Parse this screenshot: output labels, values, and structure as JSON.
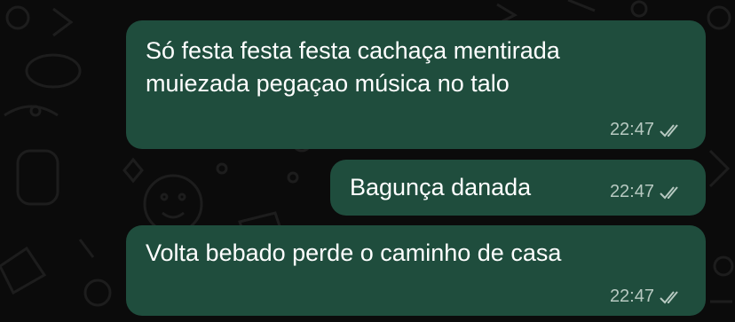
{
  "messages": [
    {
      "text_lines": [
        "Só festa festa festa cachaça mentirada",
        "muiezada pegaçao música no talo"
      ],
      "time": "22:47",
      "status_icon": "double-check-icon"
    },
    {
      "text_lines": [
        "Bagunça danada"
      ],
      "time": "22:47",
      "status_icon": "double-check-icon"
    },
    {
      "text_lines": [
        "Volta bebado perde o caminho de casa"
      ],
      "time": "22:47",
      "status_icon": "double-check-icon"
    }
  ],
  "colors": {
    "background": "#0b0b0b",
    "bubble": "#1f4d3d",
    "text": "#ffffff",
    "meta": "#b7c9c1"
  }
}
